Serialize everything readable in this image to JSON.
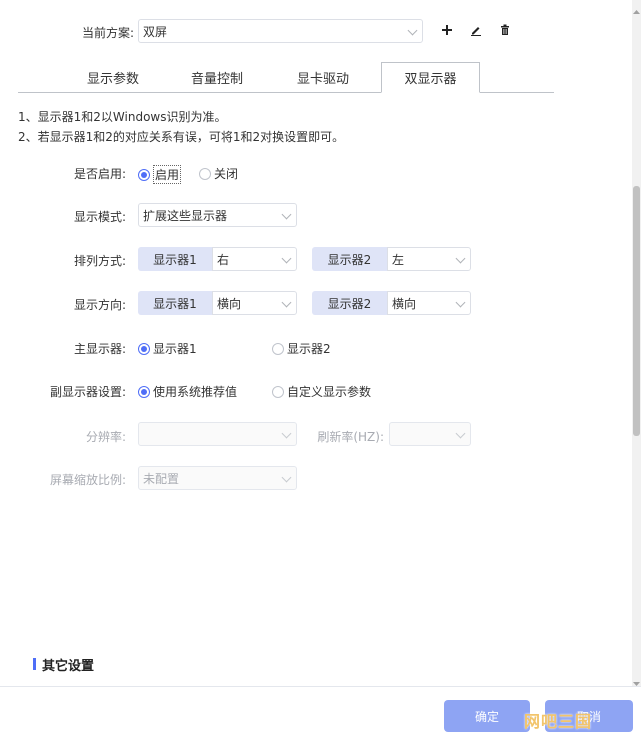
{
  "scheme": {
    "label": "当前方案:",
    "value": "双屏"
  },
  "toolbar": {
    "add_icon": "plus-icon",
    "edit_icon": "edit-icon",
    "delete_icon": "trash-icon"
  },
  "tabs": [
    {
      "label": "显示参数",
      "active": false
    },
    {
      "label": "音量控制",
      "active": false
    },
    {
      "label": "显卡驱动",
      "active": false
    },
    {
      "label": "双显示器",
      "active": true
    }
  ],
  "notes": [
    "1、显示器1和2以Windows识别为准。",
    "2、若显示器1和2的对应关系有误，可将1和2对换设置即可。"
  ],
  "enable": {
    "label": "是否启用:",
    "option_on": "启用",
    "option_off": "关闭"
  },
  "display_mode": {
    "label": "显示模式:",
    "value": "扩展这些显示器"
  },
  "arrangement": {
    "label": "排列方式:",
    "monitor1_tag": "显示器1",
    "monitor1_value": "右",
    "monitor2_tag": "显示器2",
    "monitor2_value": "左"
  },
  "orientation": {
    "label": "显示方向:",
    "monitor1_tag": "显示器1",
    "monitor1_value": "横向",
    "monitor2_tag": "显示器2",
    "monitor2_value": "横向"
  },
  "primary_display": {
    "label": "主显示器:",
    "option1": "显示器1",
    "option2": "显示器2"
  },
  "secondary_settings": {
    "label": "副显示器设置:",
    "option1": "使用系统推荐值",
    "option2": "自定义显示参数"
  },
  "resolution": {
    "label": "分辨率:",
    "value": ""
  },
  "refresh_rate": {
    "label": "刷新率(HZ):",
    "value": ""
  },
  "scaling": {
    "label": "屏幕缩放比例:",
    "value": "未配置"
  },
  "other_settings": {
    "title": "其它设置"
  },
  "footer": {
    "confirm_label": "确定",
    "cancel_label": "取消"
  },
  "watermark": "网吧三国",
  "colors": {
    "accent": "#4f6ef7",
    "tag_bg": "#dfe4f7",
    "button_bg": "#8ea4f3"
  }
}
